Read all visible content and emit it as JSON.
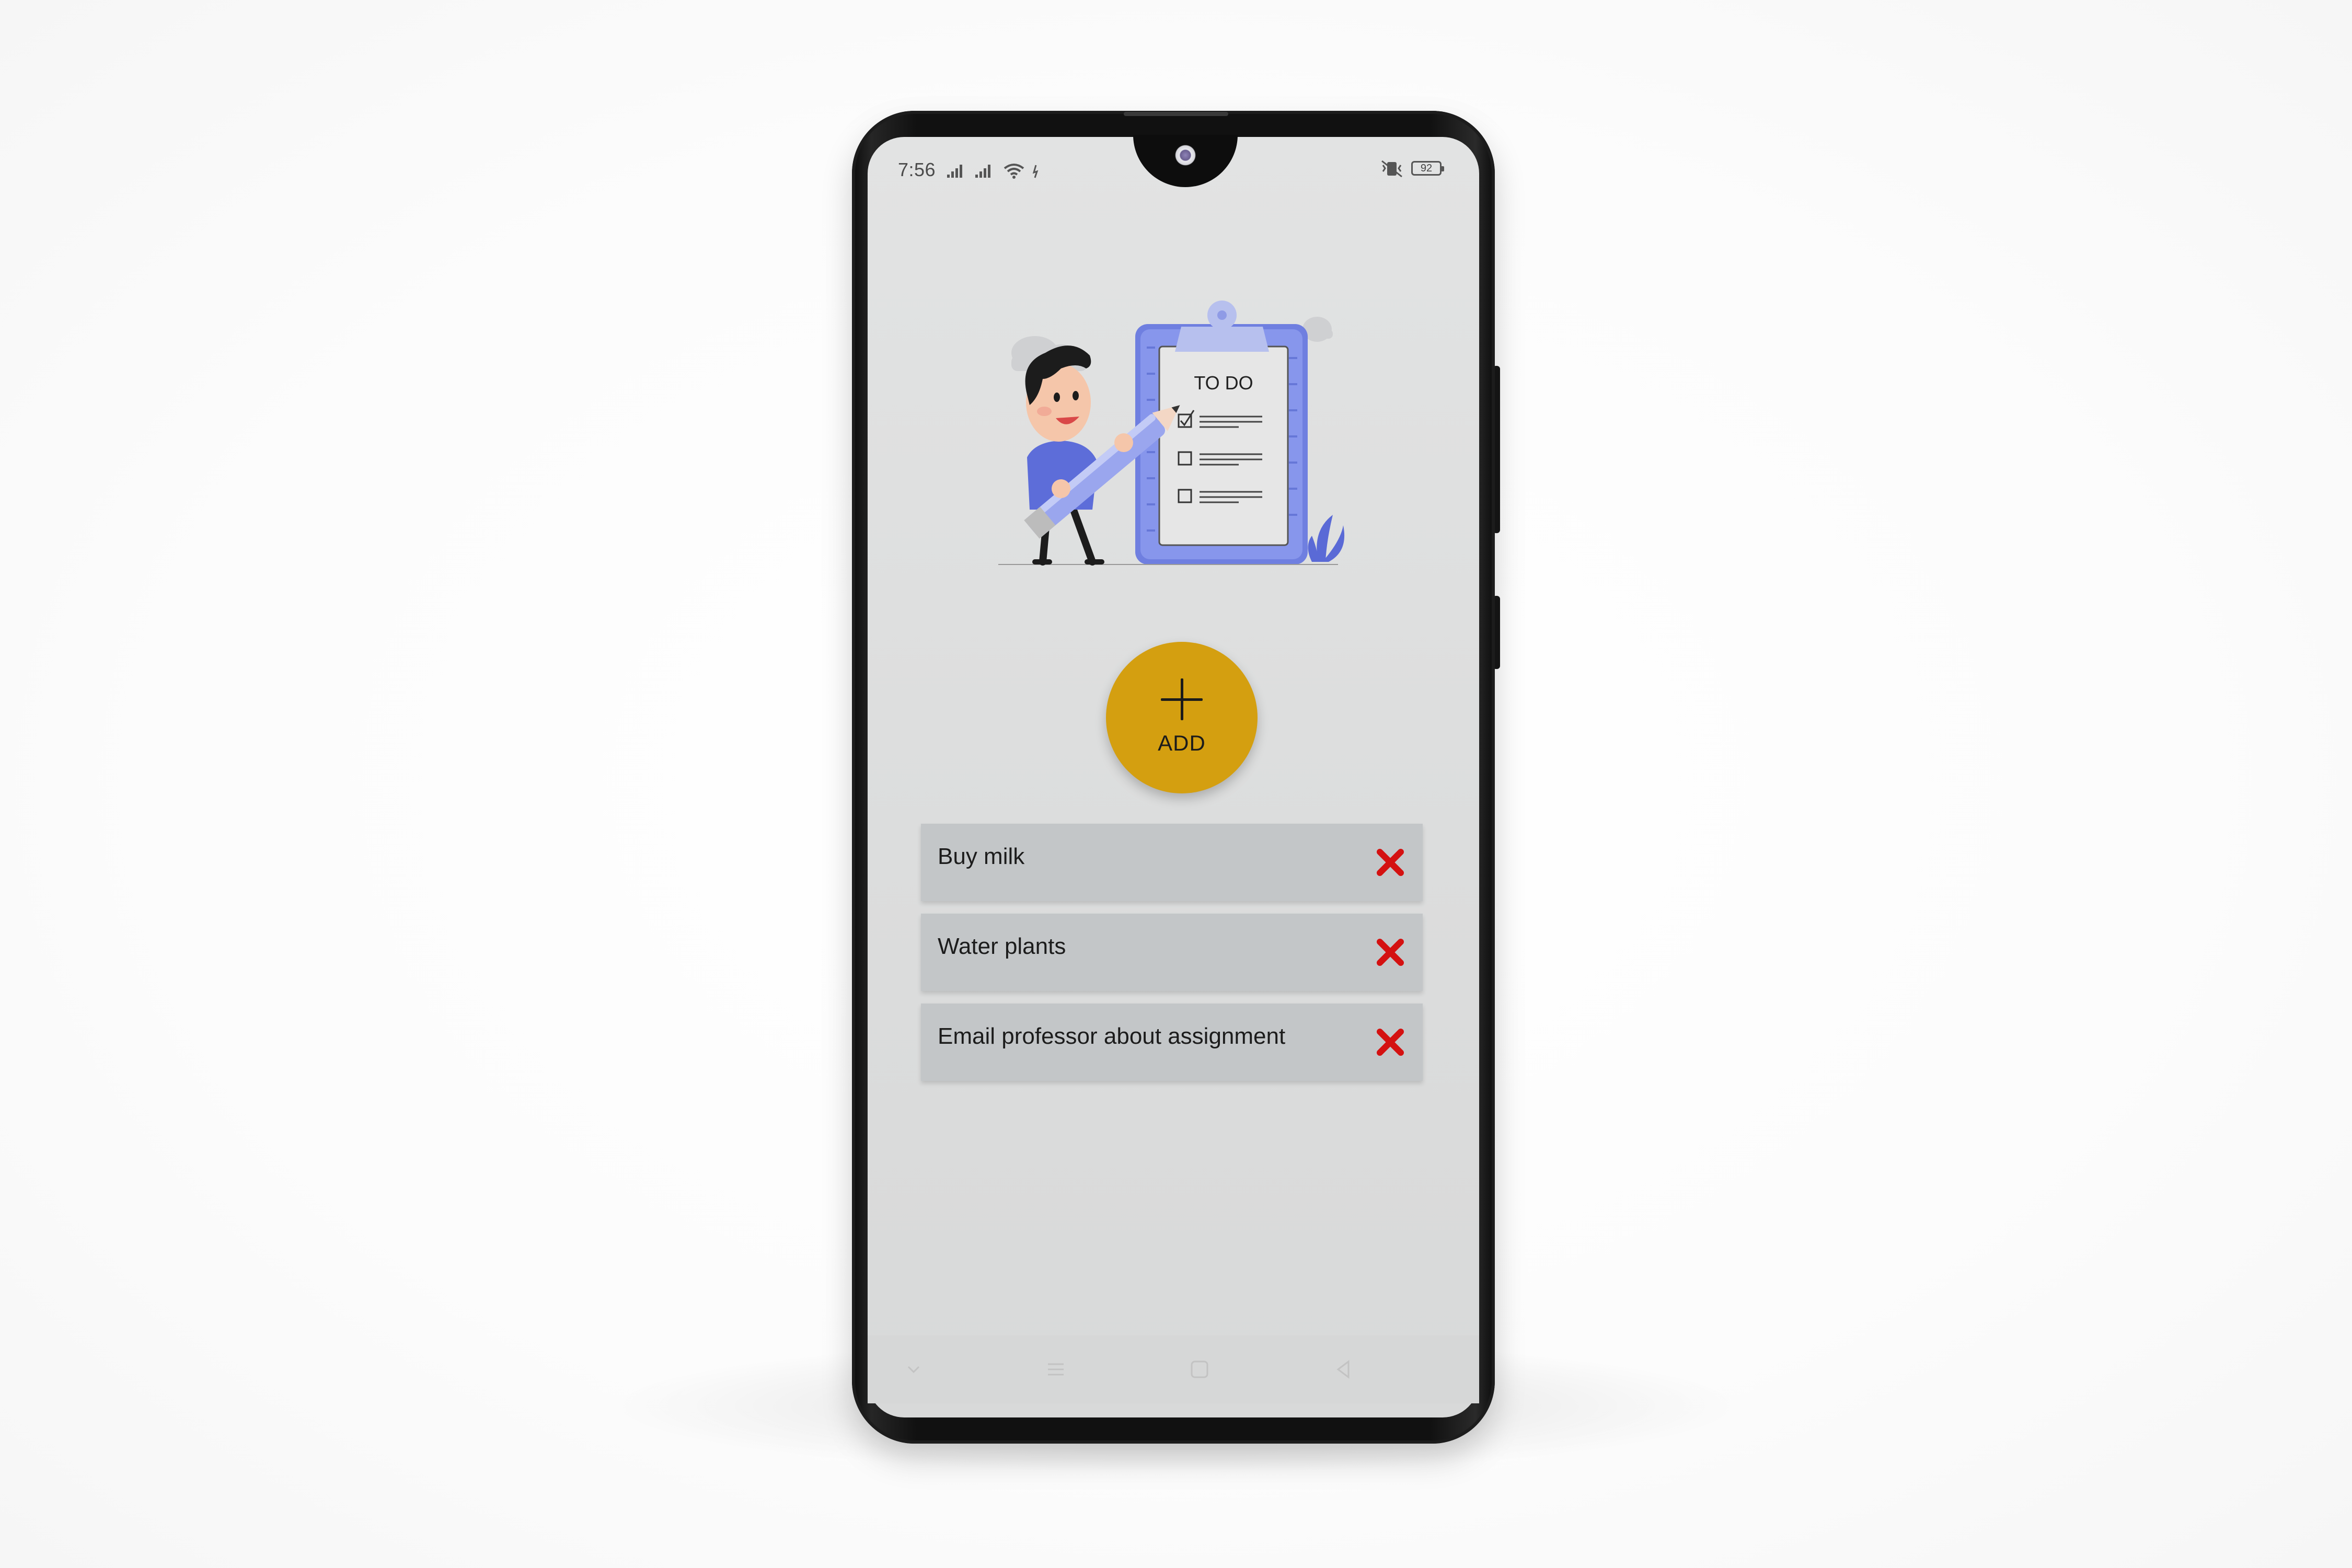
{
  "status_bar": {
    "time": "7:56",
    "battery_level": "92"
  },
  "illustration": {
    "clipboard_title": "TO DO"
  },
  "add_button": {
    "label": "ADD",
    "color": "#d49f10"
  },
  "tasks": [
    {
      "text": "Buy milk"
    },
    {
      "text": "Water plants"
    },
    {
      "text": "Email professor about assignment"
    }
  ],
  "colors": {
    "screen_background": "#e0e1e1",
    "task_background": "#c3c6c8",
    "delete_icon": "#d41111",
    "illustration_accent": "#6f7fe0"
  },
  "icons": {
    "delete": "close-x-icon",
    "add": "plus-icon",
    "nav": [
      "chevron-down-icon",
      "menu-icon",
      "home-square-icon",
      "back-triangle-icon"
    ]
  }
}
